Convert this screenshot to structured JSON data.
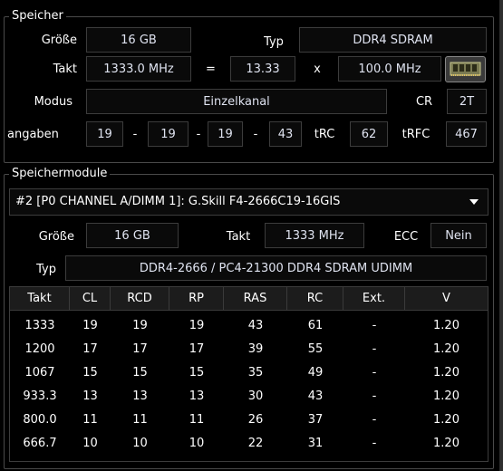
{
  "speicher": {
    "title": "Speicher",
    "groesse_label": "Größe",
    "groesse_value": "16 GB",
    "typ_label": "Typ",
    "typ_value": "DDR4 SDRAM",
    "takt_label": "Takt",
    "takt_value": "1333.0 MHz",
    "equals": "=",
    "multiplier_value": "13.33",
    "times": "x",
    "base_clock_value": "100.0 MHz",
    "memory_icon": "ram-module-icon",
    "modus_label": "Modus",
    "modus_value": "Einzelkanal",
    "cr_label": "CR",
    "cr_value": "2T",
    "timings_label": "angaben",
    "t1": "19",
    "t2": "19",
    "t3": "19",
    "t4": "43",
    "dash": "-",
    "trc_label": "tRC",
    "trc_value": "62",
    "trfc_label": "tRFC",
    "trfc_value": "467"
  },
  "module": {
    "title": "Speichermodule",
    "selected": "#2 [P0 CHANNEL A/DIMM 1]: G.Skill F4-2666C19-16GIS",
    "groesse_label": "Größe",
    "groesse_value": "16 GB",
    "takt_label": "Takt",
    "takt_value": "1333 MHz",
    "ecc_label": "ECC",
    "ecc_value": "Nein",
    "typ_label": "Typ",
    "typ_value": "DDR4-2666 / PC4-21300 DDR4 SDRAM UDIMM"
  },
  "table": {
    "headers": [
      "Takt",
      "CL",
      "RCD",
      "RP",
      "RAS",
      "RC",
      "Ext.",
      "V"
    ],
    "rows": [
      [
        "1333",
        "19",
        "19",
        "19",
        "43",
        "61",
        "-",
        "1.20"
      ],
      [
        "1200",
        "17",
        "17",
        "17",
        "39",
        "55",
        "-",
        "1.20"
      ],
      [
        "1067",
        "15",
        "15",
        "15",
        "35",
        "49",
        "-",
        "1.20"
      ],
      [
        "933.3",
        "13",
        "13",
        "13",
        "30",
        "43",
        "-",
        "1.20"
      ],
      [
        "800.0",
        "11",
        "11",
        "11",
        "26",
        "37",
        "-",
        "1.20"
      ],
      [
        "666.7",
        "10",
        "10",
        "10",
        "22",
        "31",
        "-",
        "1.20"
      ]
    ]
  },
  "colors": {
    "background": "#000000",
    "border": "#3c3c3c",
    "text": "#ffffff",
    "header_bg": "#1c1c1c"
  }
}
